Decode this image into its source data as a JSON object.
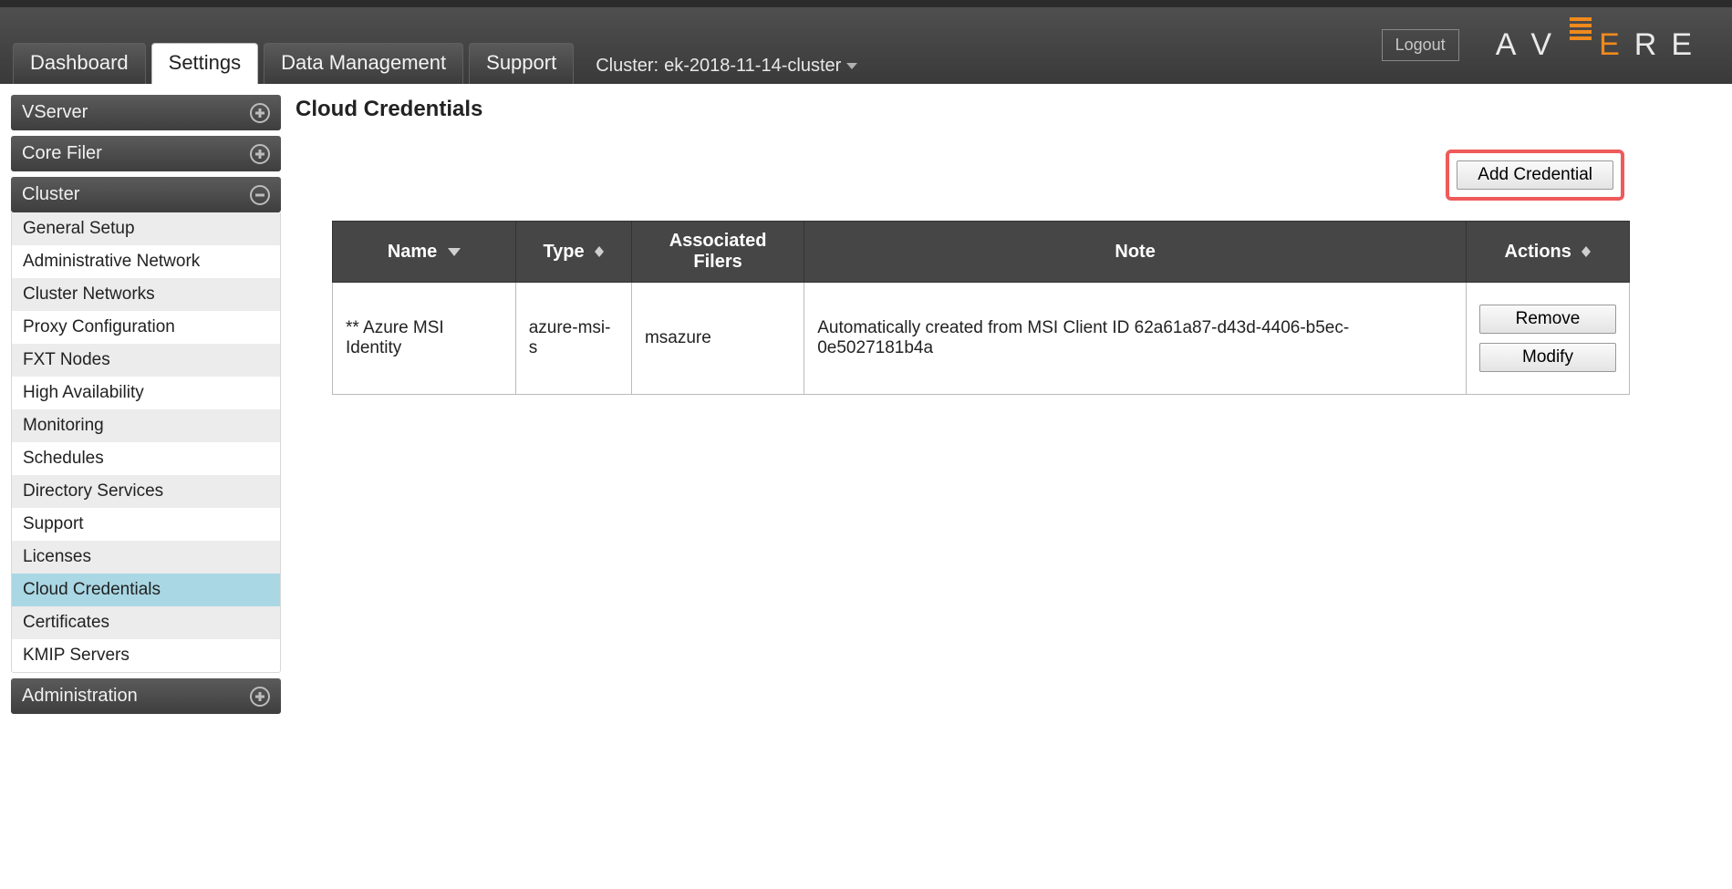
{
  "header": {
    "logout_label": "Logout",
    "brand_letters": [
      "A",
      "V",
      "E",
      "R",
      "E"
    ],
    "cluster_prefix": "Cluster:",
    "cluster_name": "ek-2018-11-14-cluster",
    "tabs": [
      {
        "label": "Dashboard",
        "active": false
      },
      {
        "label": "Settings",
        "active": true
      },
      {
        "label": "Data Management",
        "active": false
      },
      {
        "label": "Support",
        "active": false
      }
    ]
  },
  "sidebar": {
    "sections": [
      {
        "title": "VServer",
        "expanded": false
      },
      {
        "title": "Core Filer",
        "expanded": false
      },
      {
        "title": "Cluster",
        "expanded": true,
        "items": [
          "General Setup",
          "Administrative Network",
          "Cluster Networks",
          "Proxy Configuration",
          "FXT Nodes",
          "High Availability",
          "Monitoring",
          "Schedules",
          "Directory Services",
          "Support",
          "Licenses",
          "Cloud Credentials",
          "Certificates",
          "KMIP Servers"
        ],
        "selected_index": 11
      },
      {
        "title": "Administration",
        "expanded": false
      }
    ]
  },
  "main": {
    "page_title": "Cloud Credentials",
    "add_button_label": "Add Credential",
    "table": {
      "columns": [
        "Name",
        "Type",
        "Associated Filers",
        "Note",
        "Actions"
      ],
      "rows": [
        {
          "name": "** Azure MSI Identity",
          "type": "azure-msi-s",
          "associated_filers": "msazure",
          "note": "Automatically created from MSI Client ID 62a61a87-d43d-4406-b5ec-0e5027181b4a",
          "actions": {
            "remove": "Remove",
            "modify": "Modify"
          }
        }
      ]
    }
  }
}
